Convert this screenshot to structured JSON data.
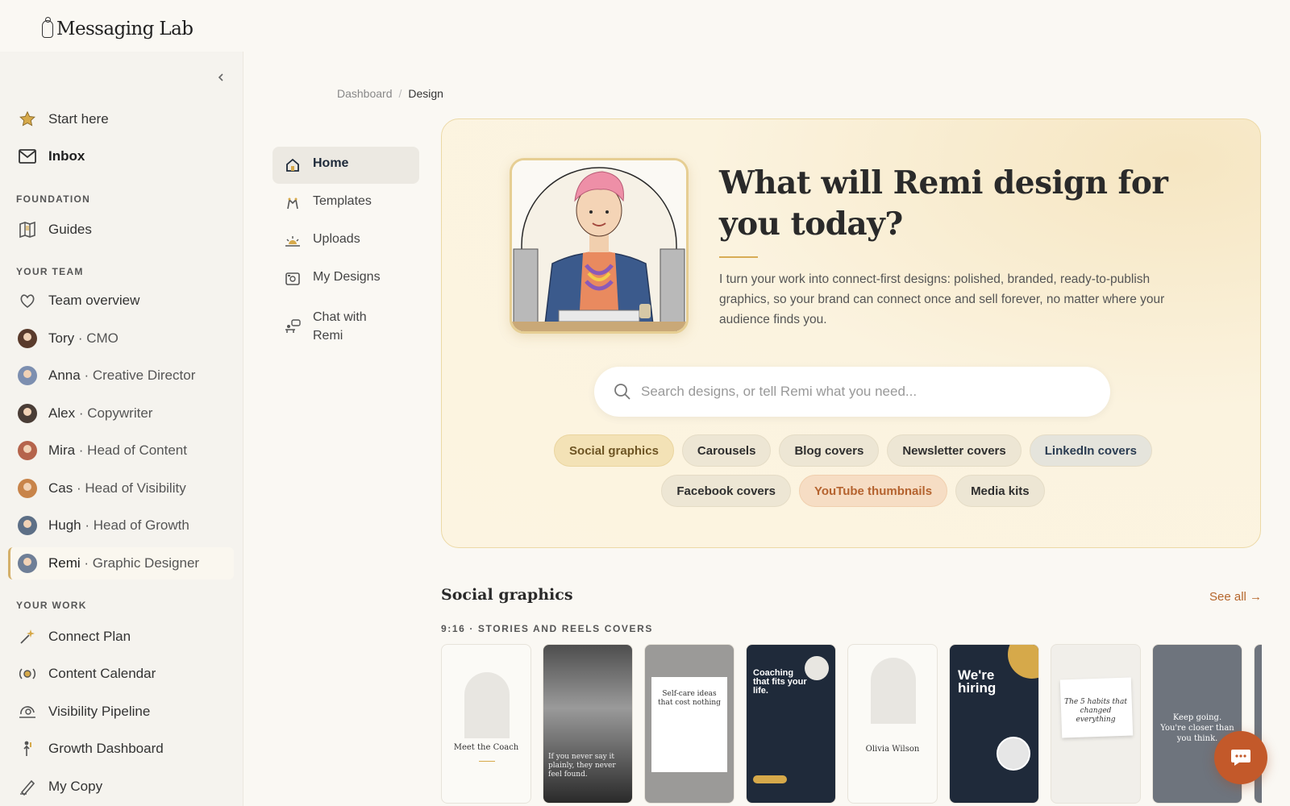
{
  "brand": {
    "name": "Messaging Lab"
  },
  "sidebar": {
    "top_items": [
      {
        "label": "Start here",
        "icon": "star-icon"
      },
      {
        "label": "Inbox",
        "icon": "mail-icon"
      }
    ],
    "foundation_header": "FOUNDATION",
    "foundation_items": [
      {
        "label": "Guides",
        "icon": "map-icon"
      }
    ],
    "team_header": "YOUR TEAM",
    "team_overview": {
      "label": "Team overview",
      "icon": "heart-hands-icon"
    },
    "team": [
      {
        "name": "Tory",
        "role": "· CMO",
        "avatar_color": "#5a3b2c"
      },
      {
        "name": "Anna",
        "role": "· Creative Director",
        "avatar_color": "#7d8fb0"
      },
      {
        "name": "Alex",
        "role": "· Copywriter",
        "avatar_color": "#4a3d36"
      },
      {
        "name": "Mira",
        "role": "· Head of Content",
        "avatar_color": "#b5644c"
      },
      {
        "name": "Cas",
        "role": "· Head of Visibility",
        "avatar_color": "#c8844a"
      },
      {
        "name": "Hugh",
        "role": "· Head of Growth",
        "avatar_color": "#5d6f86"
      },
      {
        "name": "Remi",
        "role": "· Graphic Designer",
        "avatar_color": "#6f7f97",
        "active": true
      }
    ],
    "work_header": "YOUR WORK",
    "work_items": [
      {
        "label": "Connect Plan",
        "icon": "sparkle-wand-icon"
      },
      {
        "label": "Content Calendar",
        "icon": "broadcast-icon"
      },
      {
        "label": "Visibility Pipeline",
        "icon": "magnifier-pipeline-icon"
      },
      {
        "label": "Growth Dashboard",
        "icon": "growth-figure-icon"
      },
      {
        "label": "My Copy",
        "icon": "pen-icon"
      }
    ]
  },
  "breadcrumb": {
    "parent": "Dashboard",
    "separator": "/",
    "current": "Design"
  },
  "subnav": [
    {
      "label": "Home",
      "icon": "home-icon",
      "active": true
    },
    {
      "label": "Templates",
      "icon": "templates-icon"
    },
    {
      "label": "Uploads",
      "icon": "upload-sun-icon"
    },
    {
      "label": "My Designs",
      "icon": "designs-icon"
    },
    {
      "label": "Chat with Remi",
      "icon": "chat-desk-icon"
    }
  ],
  "hero": {
    "title": "What will Remi design for you today?",
    "description": "I turn your work into connect-first designs: polished, branded, ready-to-publish graphics, so your brand can connect once and sell forever, no matter where your audience finds you.",
    "search_placeholder": "Search designs, or tell Remi what you need...",
    "chips": [
      {
        "label": "Social graphics",
        "style": "gold"
      },
      {
        "label": "Carousels",
        "style": "plain"
      },
      {
        "label": "Blog covers",
        "style": "plain"
      },
      {
        "label": "Newsletter covers",
        "style": "plain"
      },
      {
        "label": "LinkedIn covers",
        "style": "blue"
      },
      {
        "label": "Facebook covers",
        "style": "plain"
      },
      {
        "label": "YouTube thumbnails",
        "style": "peach"
      },
      {
        "label": "Media kits",
        "style": "plain"
      }
    ]
  },
  "social": {
    "title": "Social graphics",
    "see_all": "See all →",
    "sublabel": "9:16 · STORIES AND REELS COVERS",
    "cards": [
      {
        "text": "Meet the Coach",
        "theme": "light"
      },
      {
        "text": "If you never say it plainly, they never feel found.",
        "theme": "dark-gradient"
      },
      {
        "text": "Self-care ideas that cost nothing",
        "theme": "grey-paper"
      },
      {
        "text": "Coaching that fits your life.",
        "theme": "navy"
      },
      {
        "text": "Olivia Wilson",
        "theme": "light"
      },
      {
        "text": "We're hiring",
        "theme": "navy-gold"
      },
      {
        "text": "The 5 habits that changed everything",
        "theme": "note"
      },
      {
        "text": "Keep going. You're closer than you think.",
        "theme": "slate"
      }
    ]
  },
  "colors": {
    "accent": "#c3592a",
    "gold": "#d7ac55",
    "navy": "#1f2a3a"
  }
}
